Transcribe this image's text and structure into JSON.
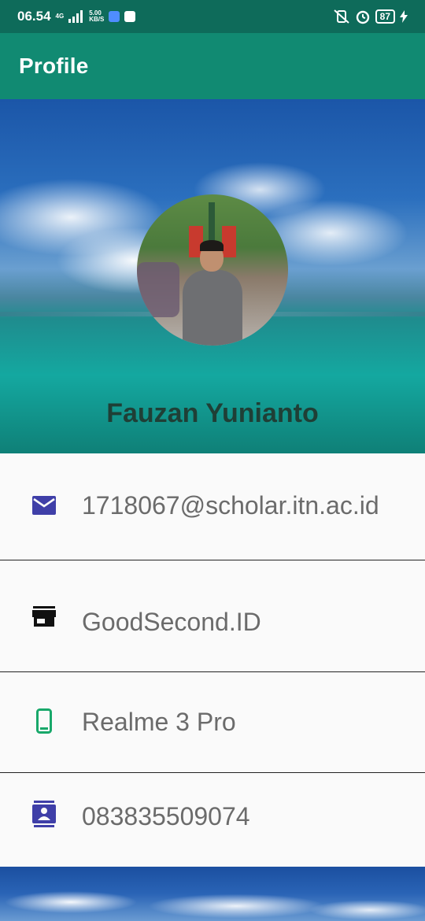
{
  "status_bar": {
    "time": "06.54",
    "network": "4G",
    "speed": "5.00",
    "speed_unit": "KB/S",
    "battery": "87"
  },
  "app_bar": {
    "title": "Profile"
  },
  "profile": {
    "name": "Fauzan Yunianto",
    "email": "1718067@scholar.itn.ac.id",
    "store": "GoodSecond.ID",
    "device": "Realme 3 Pro",
    "phone": "083835509074"
  },
  "icons": {
    "email": "email-icon",
    "store": "store-icon",
    "device": "smartphone-icon",
    "phone": "contact-card-icon"
  },
  "colors": {
    "status_bar": "#0e6b5a",
    "app_bar": "#118a72",
    "email_icon": "#3f3fa8",
    "store_icon": "#111111",
    "device_icon": "#18a86a",
    "phone_icon": "#3f3fa8",
    "text": "#6b6b6b",
    "name": "#1f3f36"
  }
}
